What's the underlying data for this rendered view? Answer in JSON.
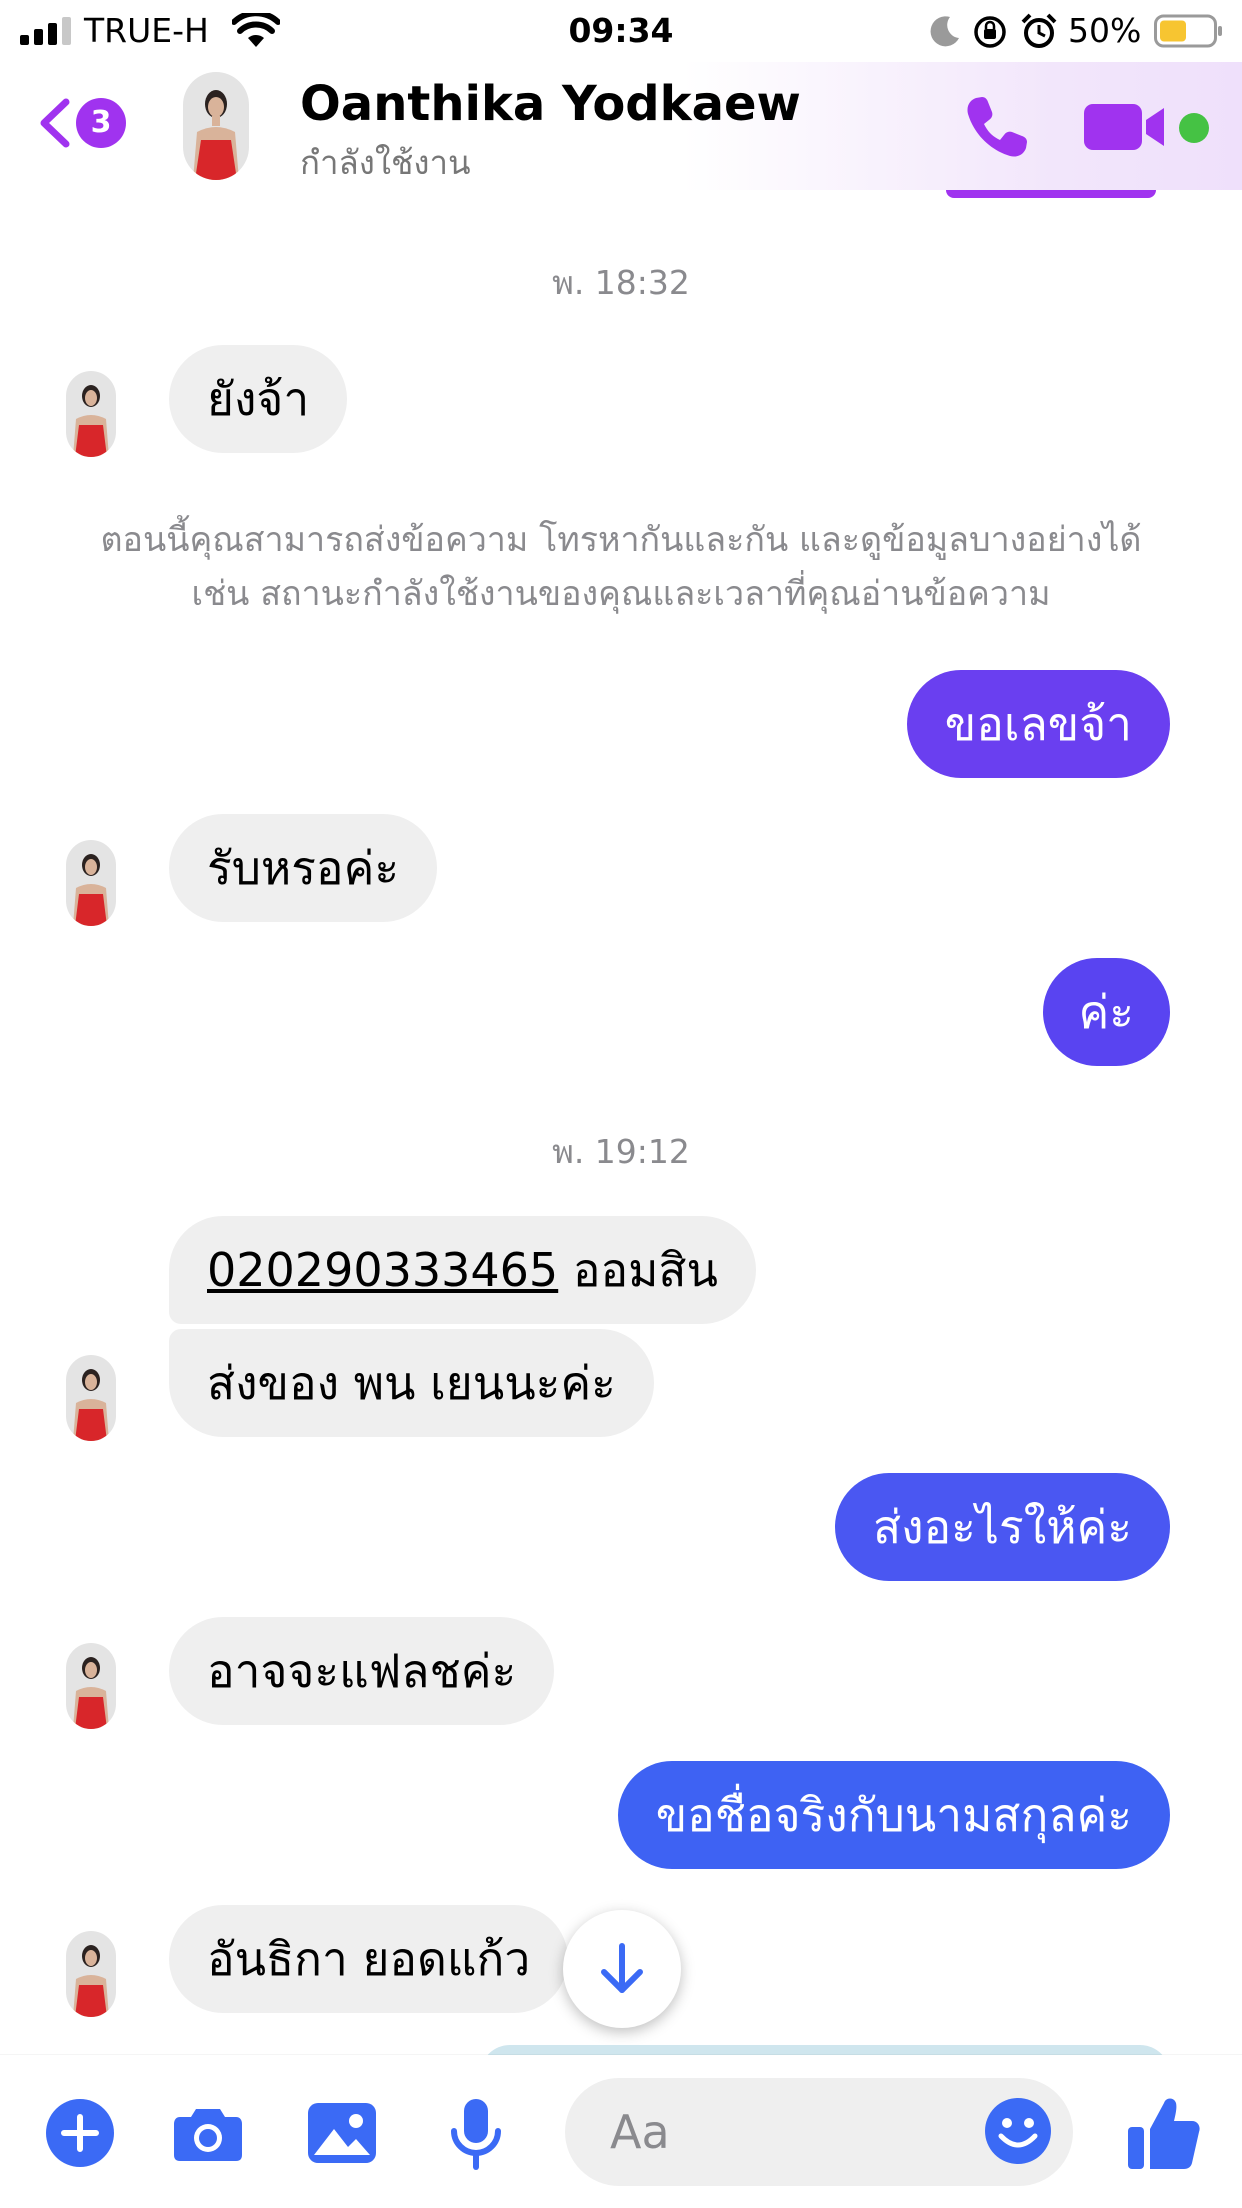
{
  "colors": {
    "accent": "#a033ef",
    "blue": "#3b6af5",
    "bubble_incoming": "#efefef",
    "online": "#45c244"
  },
  "status_bar": {
    "carrier": "TRUE-H",
    "time": "09:34",
    "battery": "50%",
    "icons": [
      "signal-icon",
      "wifi-icon",
      "moon-icon",
      "rotation-lock-icon",
      "alarm-icon",
      "battery-icon"
    ]
  },
  "header": {
    "back_count": "3",
    "name": "Oanthika Yodkaew",
    "status": "กำลังใช้งาน",
    "icons": [
      "back-chevron-icon",
      "phone-icon",
      "video-icon"
    ]
  },
  "messages": {
    "timestamp_1": "พ. 18:32",
    "m1": "ยังจ้า",
    "notice_line1": "ตอนนี้คุณสามารถส่งข้อความ โทรหากันและกัน และดูข้อมูลบางอย่างได้",
    "notice_line2": "เช่น สถานะกำลังใช้งานของคุณและเวลาที่คุณอ่านข้อความ",
    "m2": "ขอเลขจ้า",
    "m3": "รับหรอค่ะ",
    "m4": "ค่ะ",
    "timestamp_2": "พ. 19:12",
    "m5_link": "020290333465",
    "m5_rest": " ออมสิน",
    "m6": "ส่งของ พน เยนนะค่ะ",
    "m7": "ส่งอะไรให้ค่ะ",
    "m8": "อาจจะแฟลชค่ะ",
    "m9": "ขอชื่อจริงกับนามสกุลค่ะ",
    "m10": "อันธิกา ยอดแก้ว"
  },
  "composer": {
    "placeholder": "Aa",
    "icons": [
      "add-icon",
      "camera-icon",
      "gallery-icon",
      "microphone-icon",
      "emoji-icon",
      "thumbs-up-icon"
    ]
  }
}
